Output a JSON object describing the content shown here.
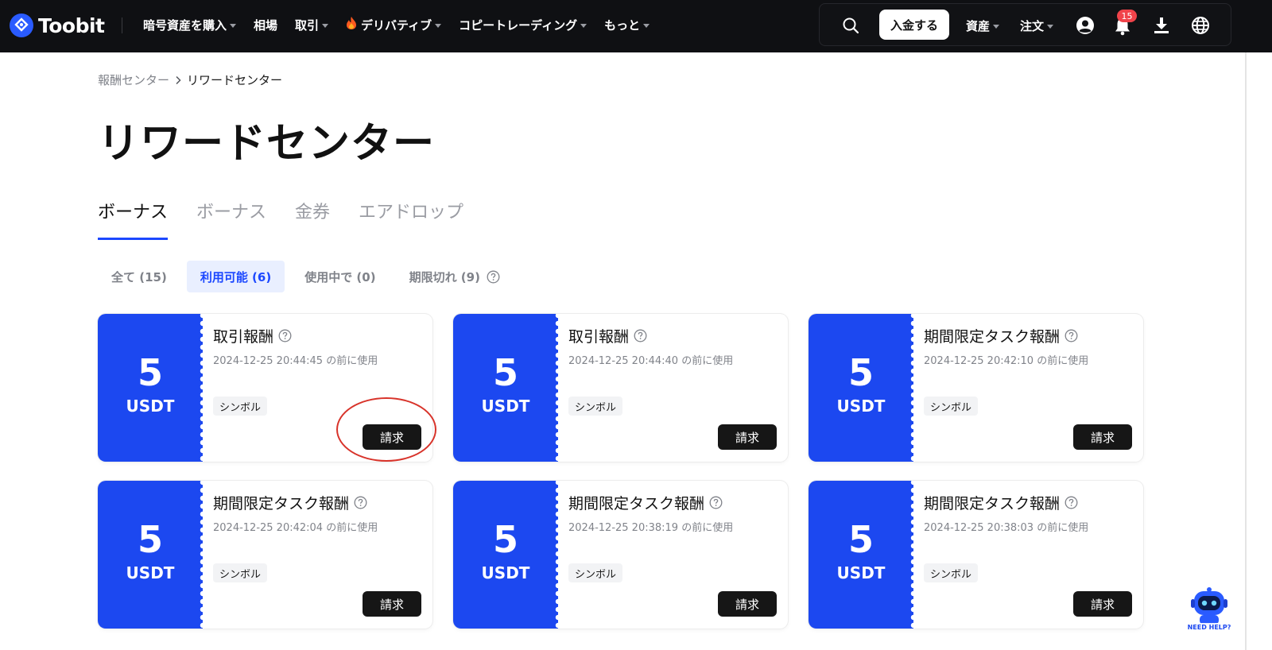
{
  "nav": {
    "brand": "Toobit",
    "menu": [
      {
        "label": "暗号資産を購入",
        "has_caret": true
      },
      {
        "label": "相場",
        "has_caret": false
      },
      {
        "label": "取引",
        "has_caret": true
      },
      {
        "label": "デリバティブ",
        "has_caret": true,
        "icon": "fire-icon"
      },
      {
        "label": "コピートレーディング",
        "has_caret": true
      },
      {
        "label": "もっと",
        "has_caret": true
      }
    ],
    "deposit_label": "入金する",
    "assets_label": "資産",
    "orders_label": "注文",
    "notification_count": "15"
  },
  "breadcrumb": {
    "parent": "報酬センター",
    "current": "リワードセンター"
  },
  "page_title": "リワードセンター",
  "tabs": [
    {
      "label": "ボーナス",
      "active": true
    },
    {
      "label": "ボーナス",
      "active": false
    },
    {
      "label": "金券",
      "active": false
    },
    {
      "label": "エアドロップ",
      "active": false
    }
  ],
  "filters": [
    {
      "label": "全て (15)",
      "active": false
    },
    {
      "label": "利用可能 (6)",
      "active": true
    },
    {
      "label": "使用中で (0)",
      "active": false
    },
    {
      "label": "期限切れ (9)",
      "active": false
    }
  ],
  "cards": [
    {
      "amount": "5",
      "unit": "USDT",
      "title": "取引報酬",
      "date": "2024-12-25 20:44:45 の前に使用",
      "tag": "シンボル",
      "button": "請求"
    },
    {
      "amount": "5",
      "unit": "USDT",
      "title": "取引報酬",
      "date": "2024-12-25 20:44:40 の前に使用",
      "tag": "シンボル",
      "button": "請求"
    },
    {
      "amount": "5",
      "unit": "USDT",
      "title": "期間限定タスク報酬",
      "date": "2024-12-25 20:42:10 の前に使用",
      "tag": "シンボル",
      "button": "請求"
    },
    {
      "amount": "5",
      "unit": "USDT",
      "title": "期間限定タスク報酬",
      "date": "2024-12-25 20:42:04 の前に使用",
      "tag": "シンボル",
      "button": "請求"
    },
    {
      "amount": "5",
      "unit": "USDT",
      "title": "期間限定タスク報酬",
      "date": "2024-12-25 20:38:19 の前に使用",
      "tag": "シンボル",
      "button": "請求"
    },
    {
      "amount": "5",
      "unit": "USDT",
      "title": "期間限定タスク報酬",
      "date": "2024-12-25 20:38:03 の前に使用",
      "tag": "シンボル",
      "button": "請求"
    }
  ],
  "helper": {
    "label": "NEED HELP?"
  },
  "colors": {
    "nav_bg": "#0f1013",
    "accent_blue": "#1c48f0",
    "button_dark": "#161616",
    "highlight_red": "#d8332a"
  }
}
